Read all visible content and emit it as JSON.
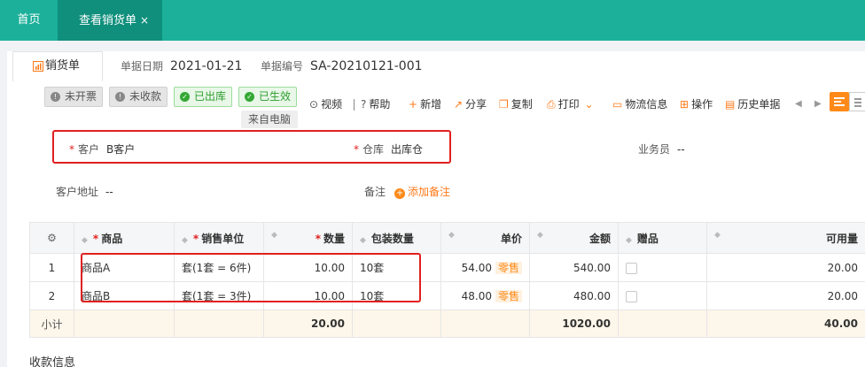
{
  "tabs": {
    "home": "首页",
    "active": "查看销货单",
    "close_glyph": "×"
  },
  "doc": {
    "tab_label": "销货单",
    "date_label": "单据日期",
    "date_value": "2021-01-21",
    "no_label": "单据编号",
    "no_value": "SA-20210121-001"
  },
  "badges": [
    {
      "label": "未开票",
      "style": "gray"
    },
    {
      "label": "未收款",
      "style": "gray"
    },
    {
      "label": "已出库",
      "style": "green"
    },
    {
      "label": "已生效",
      "style": "green"
    }
  ],
  "source_tag": "来自电脑",
  "toolbar": {
    "video": "视频",
    "help": "帮助",
    "add": "新增",
    "share": "分享",
    "copy": "复制",
    "print": "打印",
    "logistics": "物流信息",
    "ops": "操作",
    "history": "历史单据"
  },
  "form": {
    "customer_label": "客户",
    "customer_value": "B客户",
    "warehouse_label": "仓库",
    "warehouse_value": "出库仓",
    "salesman_label": "业务员",
    "salesman_value": "--",
    "address_label": "客户地址",
    "address_value": "--",
    "remark_label": "备注",
    "remark_add": "添加备注"
  },
  "table": {
    "headers": {
      "product": "商品",
      "unit": "销售单位",
      "qty": "数量",
      "pack": "包装数量",
      "price": "单价",
      "amount": "金额",
      "gift": "赠品",
      "avail": "可用量"
    },
    "retail_tag": "零售",
    "rows": [
      {
        "no": "1",
        "product": "商品A",
        "unit": "套(1套 = 6件)",
        "qty": "10.00",
        "pack": "10套",
        "price": "54.00",
        "amount": "540.00",
        "gift": false,
        "avail": "20.00"
      },
      {
        "no": "2",
        "product": "商品B",
        "unit": "套(1套 = 3件)",
        "qty": "10.00",
        "pack": "10套",
        "price": "48.00",
        "amount": "480.00",
        "gift": false,
        "avail": "20.00"
      }
    ],
    "subtotal": {
      "label": "小计",
      "qty": "20.00",
      "amount": "1020.00",
      "avail": "40.00"
    }
  },
  "sections": {
    "payment": "收款信息"
  },
  "colors": {
    "brand": "#1cb09a",
    "brand_dark": "#0f8f7c",
    "accent": "#ff8a1a",
    "required": "#e02020",
    "highlight_box": "#e02020"
  }
}
